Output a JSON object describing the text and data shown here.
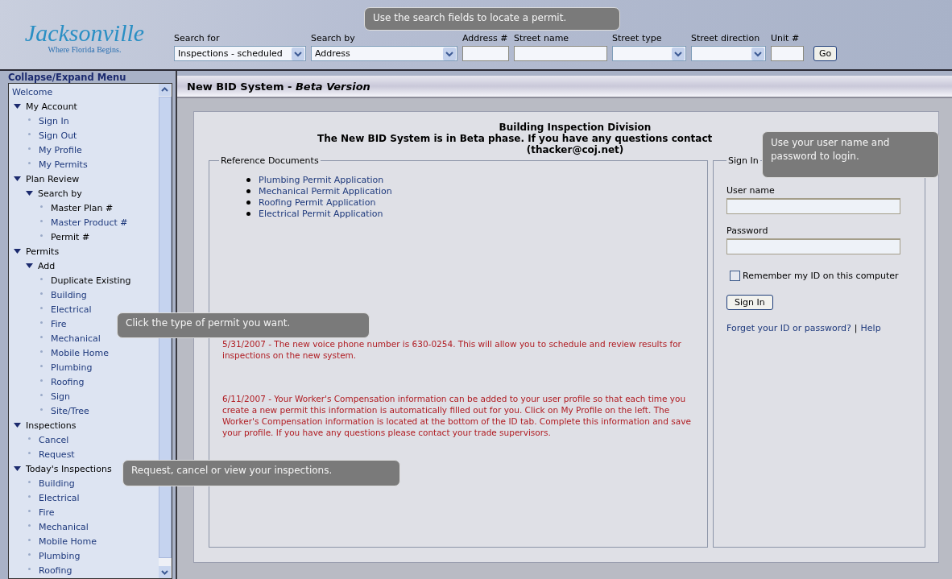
{
  "header": {
    "logo": {
      "name": "Jacksonville",
      "tagline": "Where Florida Begins."
    },
    "tooltip": "Use the search fields to locate a permit.",
    "search": [
      {
        "kind": "select",
        "label": "Search for",
        "value": "Inspections - scheduled"
      },
      {
        "kind": "select",
        "label": "Search by",
        "value": "Address"
      },
      {
        "kind": "input",
        "label": "Address #"
      },
      {
        "kind": "input",
        "label": "Street name"
      },
      {
        "kind": "select",
        "label": "Street type"
      },
      {
        "kind": "select",
        "label": "Street direction"
      },
      {
        "kind": "input",
        "label": "Unit #"
      }
    ],
    "go_button": "Go"
  },
  "sidebar": {
    "title": "Collapse/Expand Menu",
    "items": [
      {
        "label": "Welcome",
        "link": true
      },
      {
        "label": "My Account",
        "expanded": true,
        "children": [
          {
            "label": "Sign In",
            "link": true
          },
          {
            "label": "Sign Out",
            "link": true
          },
          {
            "label": "My Profile",
            "link": true
          },
          {
            "label": "My Permits",
            "link": true
          }
        ]
      },
      {
        "label": "Plan Review",
        "expanded": true,
        "children": [
          {
            "label": "Search by",
            "expanded": true,
            "children": [
              {
                "label": "Master Plan #",
                "link": false
              },
              {
                "label": "Master Product #",
                "link": true
              },
              {
                "label": "Permit #",
                "link": false
              }
            ]
          }
        ]
      },
      {
        "label": "Permits",
        "expanded": true,
        "children": [
          {
            "label": "Add",
            "expanded": true,
            "children": [
              {
                "label": "Duplicate Existing",
                "link": false
              },
              {
                "label": "Building",
                "link": true
              },
              {
                "label": "Electrical",
                "link": true
              },
              {
                "label": "Fire",
                "link": true
              },
              {
                "label": "Mechanical",
                "link": true
              },
              {
                "label": "Mobile Home",
                "link": true
              },
              {
                "label": "Plumbing",
                "link": true
              },
              {
                "label": "Roofing",
                "link": true
              },
              {
                "label": "Sign",
                "link": true
              },
              {
                "label": "Site/Tree",
                "link": true
              }
            ]
          }
        ]
      },
      {
        "label": "Inspections",
        "expanded": true,
        "children": [
          {
            "label": "Cancel",
            "link": true
          },
          {
            "label": "Request",
            "link": true
          }
        ]
      },
      {
        "label": "Today's Inspections",
        "expanded": true,
        "children": [
          {
            "label": "Building",
            "link": true
          },
          {
            "label": "Electrical",
            "link": true
          },
          {
            "label": "Fire",
            "link": true
          },
          {
            "label": "Mechanical",
            "link": true
          },
          {
            "label": "Mobile Home",
            "link": true
          },
          {
            "label": "Plumbing",
            "link": true
          },
          {
            "label": "Roofing",
            "link": true
          }
        ]
      }
    ],
    "tooltips": [
      "Click the type of permit you want.",
      "Request, cancel or view your inspections."
    ]
  },
  "main": {
    "title": "New BID System - *Beta Version*",
    "heading": [
      "Building Inspection Division",
      "The New BID System is in Beta phase. If you have any questions contact",
      "(thacker@coj.net)"
    ],
    "reference": {
      "legend": "Reference Documents",
      "documents": [
        "Plumbing Permit Application",
        "Mechanical Permit Application",
        "Roofing Permit Application",
        "Electrical Permit Application"
      ]
    },
    "notices": [
      "5/31/2007 - The new voice phone number is 630-0254. This will allow you to schedule and review results for inspections on the new system.",
      "6/11/2007 - Your Worker's Compensation information can be added to your user profile so that each time you create a new permit this information is automatically filled out for you. Click on My Profile on the left. The Worker's Compensation information is located at the bottom of the ID tab. Complete this information and save your profile. If you have any questions please contact your trade supervisors."
    ],
    "sign_in": {
      "legend": "Sign In",
      "tooltip": "Use your user name and password to login.",
      "fields": [
        {
          "label": "User name"
        },
        {
          "label": "Password"
        }
      ],
      "remember": {
        "label": "Remember my ID on this computer",
        "checked": false
      },
      "button": "Sign In",
      "links": [
        "Forget your ID or password?",
        "Help"
      ],
      "link_separator": "|"
    }
  }
}
